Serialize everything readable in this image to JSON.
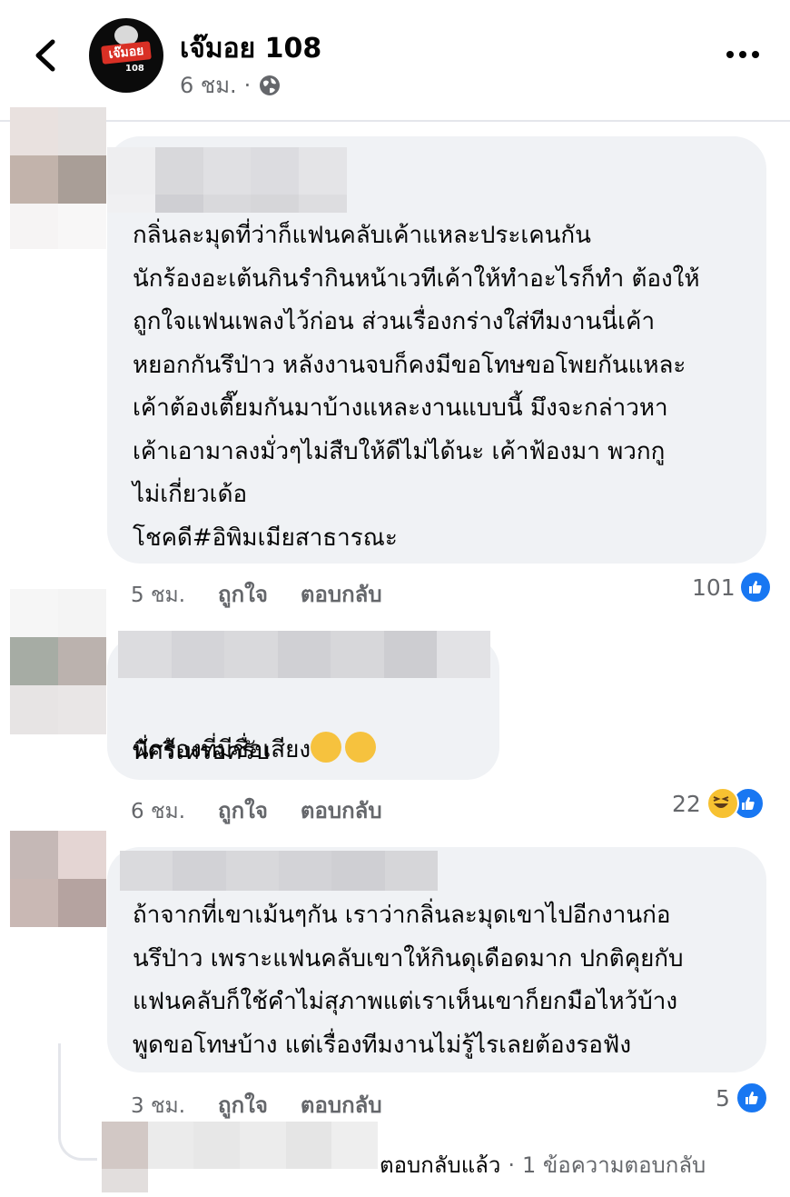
{
  "header": {
    "page_name": "เจ๊มอย 108",
    "time": "6 ชม.",
    "dot": "·"
  },
  "comments": [
    {
      "text": "กลิ่นละมุดที่ว่าก็แฟนคลับเค้าแหละประเคนกัน\nนักร้องอะเต้นกินรำกินหน้าเวทีเค้าให้ทำอะไรก็ทำ ต้องให้\nถูกใจแฟนเพลงไว้ก่อน ส่วนเรื่องกร่างใส่ทีมงานนี่เค้า\nหยอกกันรึป่าว หลังงานจบก็คงมีขอโทษขอโพยกันแหละ\nเค้าต้องเตี๊ยมกันมาบ้างแหละงานแบบนี้ มึงจะกล่าวหา\nเค้าเอามาลงมั่วๆไม่สืบให้ดีไม่ได้นะ เค้าฟ้องมา พวกกู\nไม่เกี่ยวเด้อ\nโชคดี#อิพิมเมียสาธารณะ",
      "time": "5 ชม.",
      "like": "ถูกใจ",
      "reply": "ตอบกลับ",
      "reactions": "101"
    },
    {
      "text": "นักร้องที่มีชื่อเสียง",
      "text2": "พี่ศรีเหรอครับ",
      "time": "6 ชม.",
      "like": "ถูกใจ",
      "reply": "ตอบกลับ",
      "reactions": "22"
    },
    {
      "text": "ถ้าจากที่เขาเม้นๆกัน เราว่ากลิ่นละมุดเขาไปอีกงานก่อ\nนรึป่าว เพราะแฟนคลับเขาให้กินดุเดือดมาก ปกติคุยกับ\nแฟนคลับก็ใช้คำไม่สุภาพแต่เราเห็นเขาก็ยกมือไหว้บ้าง\nพูดขอโทษบ้าง แต่เรื่องทีมงานไม่รู้ไรเลยต้องรอฟัง",
      "time": "3 ชม.",
      "like": "ถูกใจ",
      "reply": "ตอบกลับ",
      "reactions": "5",
      "replies_label": "ตอบกลับแล้ว",
      "replies_count": "1 ข้อความตอบกลับ"
    }
  ],
  "icons": {
    "back": "chevron-left-icon",
    "more": "more-horizontal-icon",
    "audience": "globe-icon",
    "like": "like-reaction-icon",
    "haha": "haha-reaction-icon",
    "thinking": "thinking-emoji-icon"
  },
  "colors": {
    "bubble": "#f0f2f5",
    "muted": "#65676b",
    "like_blue": "#1877f2"
  }
}
